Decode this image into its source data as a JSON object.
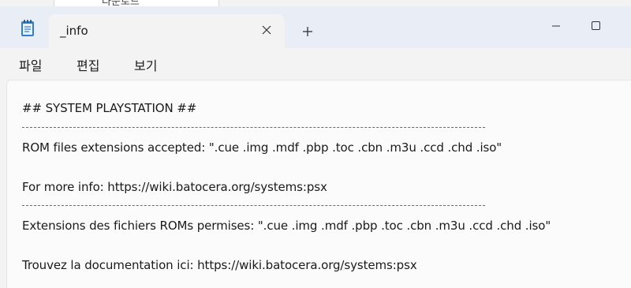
{
  "background_window": {
    "text": "다운로드"
  },
  "tab": {
    "title": "_info"
  },
  "new_tab_symbol": "+",
  "menu": {
    "items": [
      "파일",
      "편집",
      "보기"
    ]
  },
  "content": {
    "lines": [
      "## SYSTEM PLAYSTATION ##",
      "--------------------------------------------------------------------------------",
      "ROM files extensions accepted: \".cue .img .mdf .pbp .toc .cbn .m3u .ccd .chd .iso\"",
      "",
      "For more info: https://wiki.batocera.org/systems:psx",
      "--------------------------------------------------------------------------------",
      "Extensions des fichiers ROMs permises: \".cue .img .mdf .pbp .toc .cbn .m3u .ccd .chd .iso\"",
      "",
      "Trouvez la documentation ici: https://wiki.batocera.org/systems:psx"
    ]
  },
  "icons": {
    "app": "notepad-icon",
    "close": "close-icon",
    "new_tab": "plus-icon",
    "minimize": "minimize-icon",
    "maximize": "maximize-icon"
  },
  "colors": {
    "tabbar_bg": "#e9eef6",
    "active_tab_bg": "#f3f3f3",
    "editor_bg": "#fbfbfb",
    "text": "#1a1a1a",
    "icon_accent": "#2f7fd1"
  }
}
